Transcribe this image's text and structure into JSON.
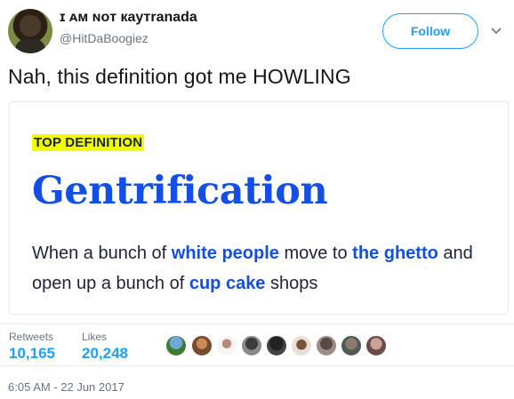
{
  "user": {
    "display_name": "ɪ ᴀм ɴoт кaутranada",
    "handle": "@HitDaBoogiez",
    "follow_label": "Follow"
  },
  "tweet": {
    "text": "Nah, this definition got me HOWLING",
    "timestamp": "6:05 AM - 22 Jun 2017"
  },
  "card": {
    "badge": "TOP DEFINITION",
    "word": "Gentrification",
    "definition": {
      "part1": "When a bunch of ",
      "link1": "white people",
      "part2": " move to ",
      "link2": "the ghetto",
      "part3": " and open up a bunch of ",
      "link3": "cup cake",
      "part4": " shops"
    }
  },
  "stats": {
    "retweets_label": "Retweets",
    "retweets_value": "10,165",
    "likes_label": "Likes",
    "likes_value": "20,248"
  },
  "colors": {
    "accent": "#1da1f2",
    "ud_blue": "#134fe6",
    "ud_highlight": "#f0ff00"
  }
}
